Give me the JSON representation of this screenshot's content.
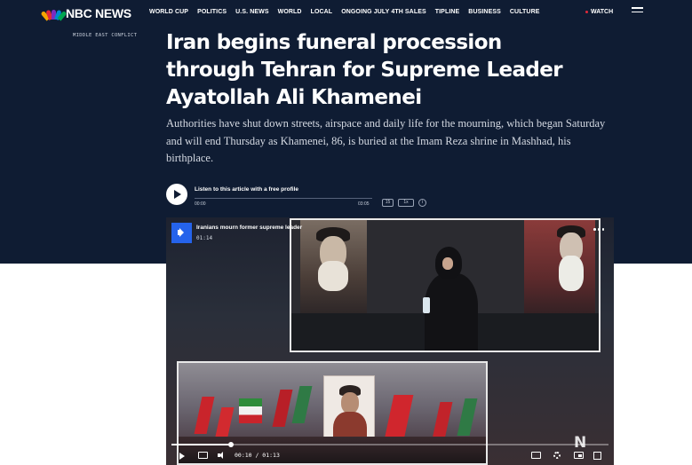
{
  "brand": {
    "name": "NBC NEWS",
    "peacock_colors": [
      "#f6a400",
      "#e0293a",
      "#7b2cbf",
      "#0089d0",
      "#00a651",
      "#fcb415"
    ]
  },
  "nav": {
    "links": [
      "WORLD CUP",
      "POLITICS",
      "U.S. NEWS",
      "WORLD",
      "LOCAL",
      "ONGOING JULY 4TH SALES",
      "TIPLINE",
      "BUSINESS",
      "CULTURE"
    ],
    "watch_label": "WATCH",
    "menu_icon": "hamburger-menu-icon"
  },
  "article": {
    "kicker": "MIDDLE EAST CONFLICT",
    "headline": "Iran begins funeral procession through Tehran for Supreme Leader Ayatollah Ali Khamenei",
    "dek": "Authorities have shut down streets, airspace and daily life for the mourning, which began Saturday and will end Thursday as Khamenei, 86, is buried at the Imam Reza shrine in Mashhad, his birthplace."
  },
  "audio": {
    "title": "Listen to this article with a free profile",
    "time_start": "00:00",
    "time_end": "03:05",
    "rewind_label": "15",
    "speed_label": "1x",
    "info_label": "i"
  },
  "video": {
    "title": "Iranians mourn former supreme leader",
    "duration": "01:14",
    "time_display": "00:10 / 01:13",
    "progress": 0.137,
    "watermark": "N",
    "accent_color": "#2563eb"
  },
  "colors": {
    "hero_background": "#0f1c33",
    "watch_dot": "#e0293a"
  }
}
